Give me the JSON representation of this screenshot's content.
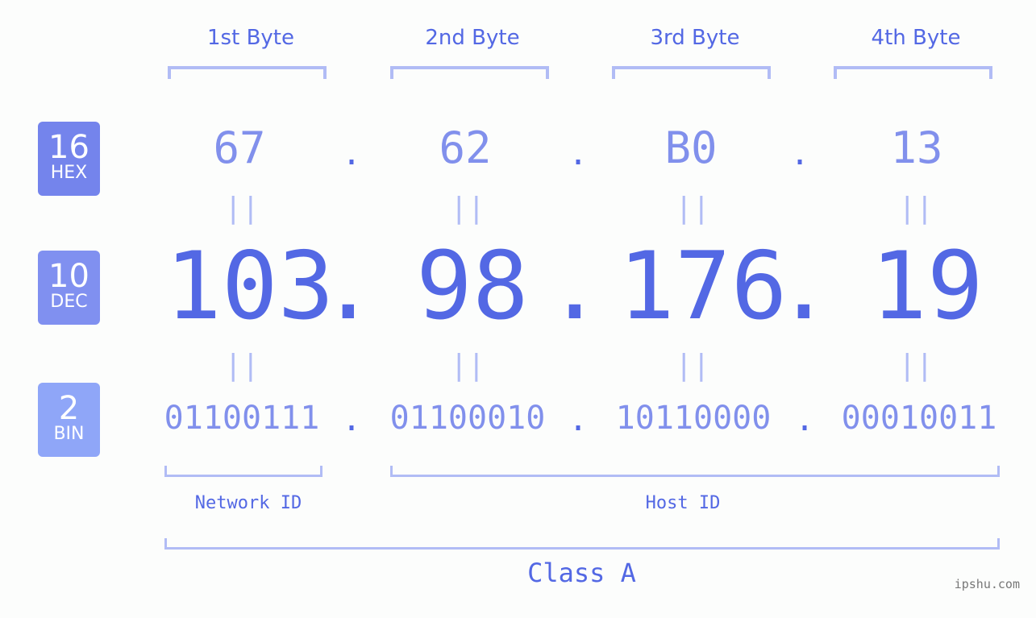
{
  "byte_headers": [
    "1st Byte",
    "2nd Byte",
    "3rd Byte",
    "4th Byte"
  ],
  "badges": {
    "hex": {
      "num": "16",
      "label": "HEX",
      "color": "#7484ec"
    },
    "dec": {
      "num": "10",
      "label": "DEC",
      "color": "#8090f0"
    },
    "bin": {
      "num": "2",
      "label": "BIN",
      "color": "#8fa6f8"
    }
  },
  "hex_values": [
    "67",
    "62",
    "B0",
    "13"
  ],
  "dec_values": [
    "103",
    "98",
    "176",
    "19"
  ],
  "bin_values": [
    "01100111",
    "01100010",
    "10110000",
    "00010011"
  ],
  "separator": ".",
  "equals": "||",
  "network_id_label": "Network ID",
  "host_id_label": "Host ID",
  "class_label": "Class A",
  "credit": "ipshu.com",
  "colors": {
    "accent": "#5368e4",
    "light": "#8190ec",
    "bracket": "#b1bcf5"
  }
}
